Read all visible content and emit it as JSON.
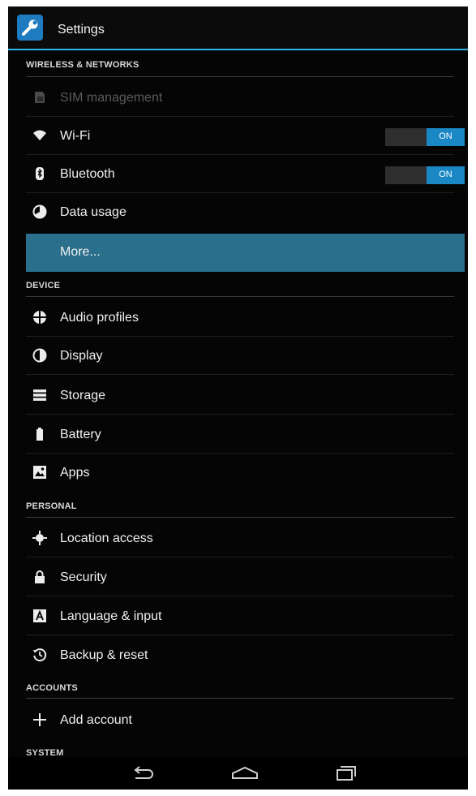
{
  "app": {
    "title": "Settings",
    "icon": "wrench-settings-icon",
    "accent": "#33b5e5"
  },
  "sections": [
    {
      "header": "WIRELESS & NETWORKS",
      "items": [
        {
          "label": "SIM management",
          "icon": "sim-icon",
          "state": "disabled"
        },
        {
          "label": "Wi-Fi",
          "icon": "wifi-icon",
          "toggle": "ON"
        },
        {
          "label": "Bluetooth",
          "icon": "bluetooth-icon",
          "toggle": "ON"
        },
        {
          "label": "Data usage",
          "icon": "data-usage-icon"
        },
        {
          "label": "More...",
          "icon": "",
          "state": "selected"
        }
      ]
    },
    {
      "header": "DEVICE",
      "items": [
        {
          "label": "Audio profiles",
          "icon": "audio-profiles-icon"
        },
        {
          "label": "Display",
          "icon": "display-icon"
        },
        {
          "label": "Storage",
          "icon": "storage-icon"
        },
        {
          "label": "Battery",
          "icon": "battery-icon"
        },
        {
          "label": "Apps",
          "icon": "apps-icon"
        }
      ]
    },
    {
      "header": "PERSONAL",
      "items": [
        {
          "label": "Location access",
          "icon": "location-icon"
        },
        {
          "label": "Security",
          "icon": "lock-icon"
        },
        {
          "label": "Language & input",
          "icon": "keyboard-a-icon"
        },
        {
          "label": "Backup & reset",
          "icon": "backup-reset-icon"
        }
      ]
    },
    {
      "header": "ACCOUNTS",
      "items": [
        {
          "label": "Add account",
          "icon": "plus-icon"
        }
      ]
    },
    {
      "header": "SYSTEM",
      "items": []
    }
  ],
  "navbar": {
    "buttons": [
      "back-icon",
      "home-icon",
      "recent-apps-icon"
    ]
  },
  "colors": {
    "selected_row": "#2a6f8c",
    "toggle_on": "#1a88c4",
    "background": "#050505"
  }
}
